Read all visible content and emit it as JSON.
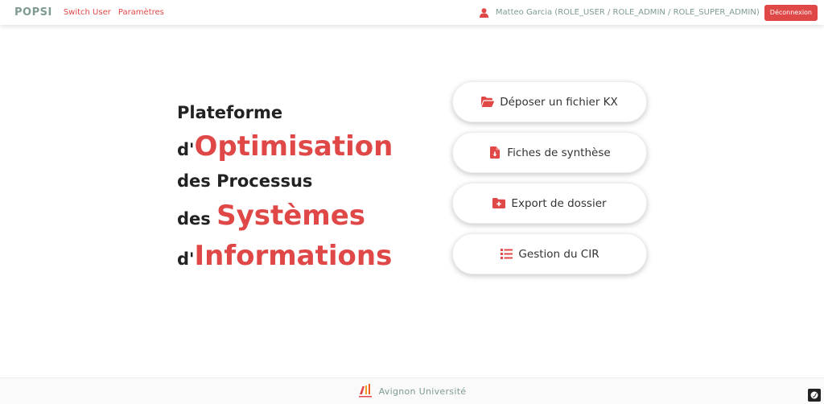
{
  "navbar": {
    "brand": "POPSI",
    "links": [
      "Switch User",
      "Paramètres"
    ],
    "user": "Matteo Garcia (ROLE_USER / ROLE_ADMIN / ROLE_SUPER_ADMIN)",
    "logout_label": "Déconnexion"
  },
  "hero": {
    "line1": "Plateforme",
    "line2_prefix": "d'",
    "line2_word": "Optimisation",
    "line3": "des Processus",
    "line4_prefix": "des ",
    "line4_word": "Systèmes",
    "line5_prefix": "d'",
    "line5_word": "Informations"
  },
  "actions": [
    {
      "label": "Déposer un fichier KX",
      "icon": "folder-open-icon"
    },
    {
      "label": "Fiches de synthèse",
      "icon": "file-download-icon"
    },
    {
      "label": "Export de dossier",
      "icon": "folder-plus-icon"
    },
    {
      "label": "Gestion du CIR",
      "icon": "list-icon"
    }
  ],
  "footer": {
    "university": "Avignon Université",
    "logo_icon": "avignon-universite-logo"
  },
  "colors": {
    "accent": "#e04848",
    "brand": "#7e9b91",
    "text": "#222222"
  }
}
